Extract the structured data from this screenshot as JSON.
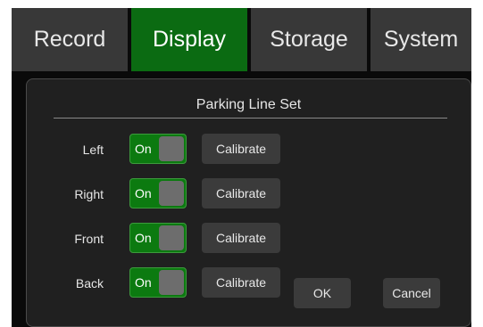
{
  "tabs": [
    {
      "label": "Record",
      "active": false
    },
    {
      "label": "Display",
      "active": true
    },
    {
      "label": "Storage",
      "active": false
    },
    {
      "label": "System",
      "active": false
    }
  ],
  "dialog": {
    "title": "Parking Line Set",
    "rows": [
      {
        "label": "Left",
        "toggle": "On",
        "state": true,
        "action": "Calibrate"
      },
      {
        "label": "Right",
        "toggle": "On",
        "state": true,
        "action": "Calibrate"
      },
      {
        "label": "Front",
        "toggle": "On",
        "state": true,
        "action": "Calibrate"
      },
      {
        "label": "Back",
        "toggle": "On",
        "state": true,
        "action": "Calibrate"
      }
    ],
    "ok_label": "OK",
    "cancel_label": "Cancel"
  },
  "colors": {
    "active_tab": "#0b6b12",
    "tab": "#383838",
    "toggle_on": "#0c7a10",
    "panel": "#202020"
  }
}
